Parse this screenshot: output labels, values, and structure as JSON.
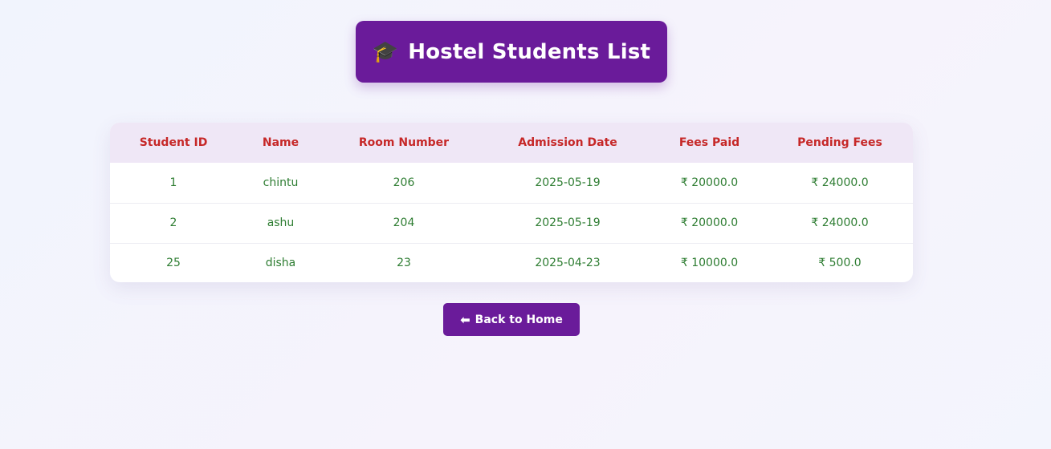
{
  "header": {
    "icon": "graduation-cap-icon",
    "icon_glyph": "🎓",
    "title": "Hostel Students List"
  },
  "table": {
    "columns": [
      "Student ID",
      "Name",
      "Room Number",
      "Admission Date",
      "Fees Paid",
      "Pending Fees"
    ],
    "rows": [
      [
        "1",
        "chintu",
        "206",
        "2025-05-19",
        "₹ 20000.0",
        "₹ 24000.0"
      ],
      [
        "2",
        "ashu",
        "204",
        "2025-05-19",
        "₹ 20000.0",
        "₹ 24000.0"
      ],
      [
        "25",
        "disha",
        "23",
        "2025-04-23",
        "₹ 10000.0",
        "₹ 500.0"
      ]
    ]
  },
  "back_button": {
    "arrow": "⬅",
    "label": "Back to Home"
  },
  "colors": {
    "primary": "#6a1b9a",
    "header_text": "#c62828",
    "cell_text": "#2e7d32",
    "table_header_bg": "#efe7f6"
  }
}
